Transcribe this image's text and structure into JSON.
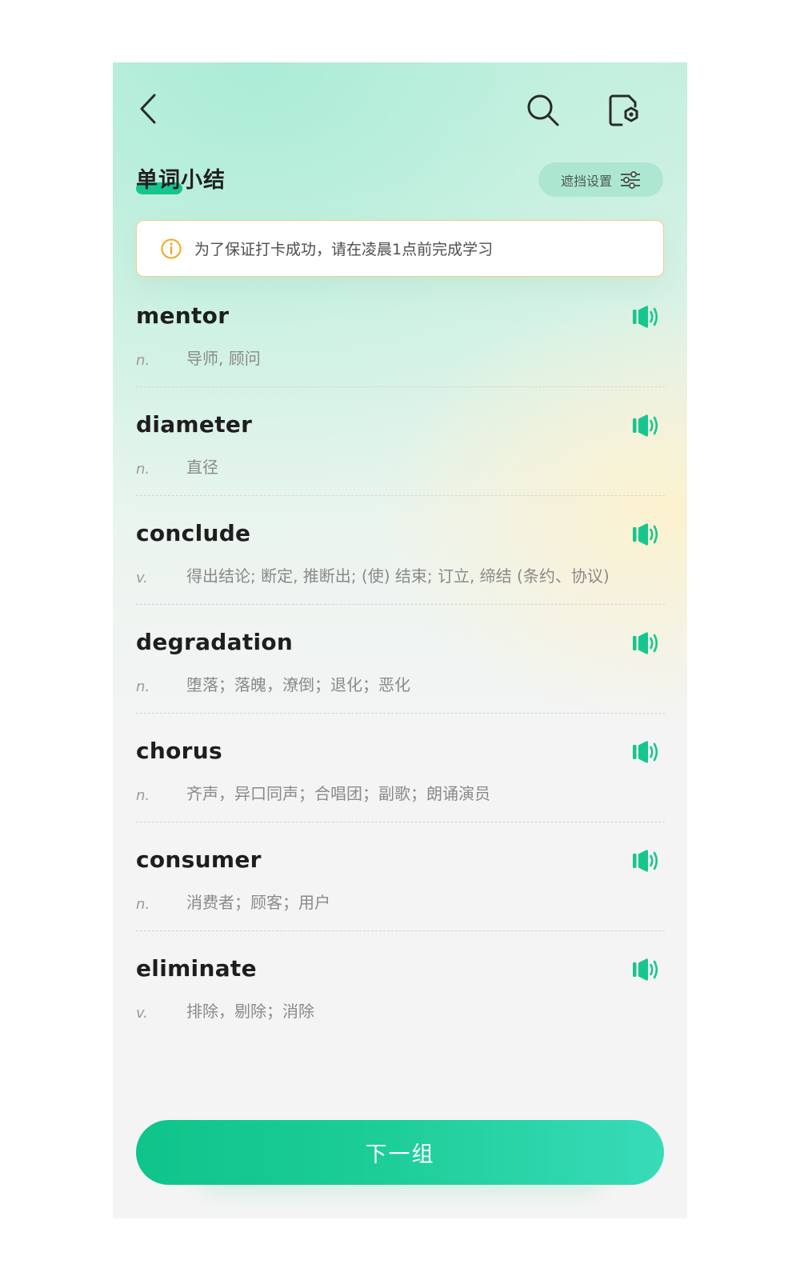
{
  "header": {
    "back_icon": "chevron-left-icon",
    "search_icon": "search-icon",
    "doc_settings_icon": "document-settings-icon",
    "title": "单词小结",
    "mask_settings_label": "遮挡设置",
    "mask_settings_icon": "sliders-icon"
  },
  "notice": {
    "icon": "info-icon",
    "text": "为了保证打卡成功，请在凌晨1点前完成学习",
    "color": "#f5a623"
  },
  "words": [
    {
      "word": "mentor",
      "pos": "n.",
      "meaning": "导师, 顾问"
    },
    {
      "word": "diameter",
      "pos": "n.",
      "meaning": "直径"
    },
    {
      "word": "conclude",
      "pos": "v.",
      "meaning": "得出结论; 断定, 推断出; (使) 结束; 订立, 缔结 (条约、协议)"
    },
    {
      "word": "degradation",
      "pos": "n.",
      "meaning": "堕落；落魄，潦倒；退化；恶化"
    },
    {
      "word": "chorus",
      "pos": "n.",
      "meaning": "齐声，异口同声；合唱团；副歌；朗诵演员"
    },
    {
      "word": "consumer",
      "pos": "n.",
      "meaning": "消费者；顾客；用户"
    },
    {
      "word": "eliminate",
      "pos": "v.",
      "meaning": "排除，剔除；消除"
    }
  ],
  "speaker_icon": "speaker-icon",
  "next_button_label": "下一组",
  "colors": {
    "accent": "#16c68e",
    "notice_border": "#f6cb87"
  }
}
